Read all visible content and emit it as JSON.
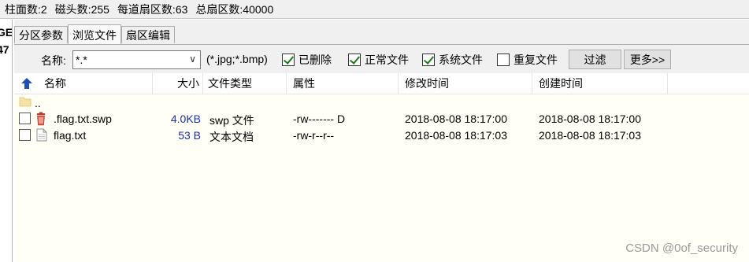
{
  "status_bar": {
    "cylinders": "柱面数:2",
    "heads": "磁头数:255",
    "sectors_per_track": "每道扇区数:63",
    "total_sectors": "总扇区数:40000"
  },
  "left_strip": {
    "line1": "GE",
    "line2": "47"
  },
  "tabs": [
    {
      "label": "分区参数",
      "active": false
    },
    {
      "label": "浏览文件",
      "active": true
    },
    {
      "label": "扇区编辑",
      "active": false
    }
  ],
  "filter": {
    "name_label": "名称:",
    "name_value": "*.*",
    "ext_hint": "(*.jpg;*.bmp)",
    "checkboxes": [
      {
        "label": "已删除",
        "checked": true
      },
      {
        "label": "正常文件",
        "checked": true
      },
      {
        "label": "系统文件",
        "checked": true
      },
      {
        "label": "重复文件",
        "checked": false
      }
    ],
    "filter_button": "过滤",
    "more_button": "更多>>"
  },
  "columns": [
    "名称",
    "大小",
    "文件类型",
    "属性",
    "修改时间",
    "创建时间"
  ],
  "rows": [
    {
      "name": "..",
      "size": "",
      "type": "",
      "attr": "",
      "modified": "",
      "created": "",
      "icon": "folder-icon"
    },
    {
      "name": ".flag.txt.swp",
      "size": "4.0KB",
      "type": "swp 文件",
      "attr": "-rw------- D",
      "modified": "2018-08-08 18:17:00",
      "created": "2018-08-08 18:17:00",
      "icon": "deleted-file-icon"
    },
    {
      "name": "flag.txt",
      "size": "53 B",
      "type": "文本文档",
      "attr": "-rw-r--r--",
      "modified": "2018-08-08 18:17:03",
      "created": "2018-08-08 18:17:03",
      "icon": "text-file-icon"
    }
  ],
  "watermark": "CSDN @0of_security",
  "colors": {
    "size_text": "#1b2fa8",
    "panel_bg": "#fffff5",
    "check_mark": "#1a7a1a"
  }
}
